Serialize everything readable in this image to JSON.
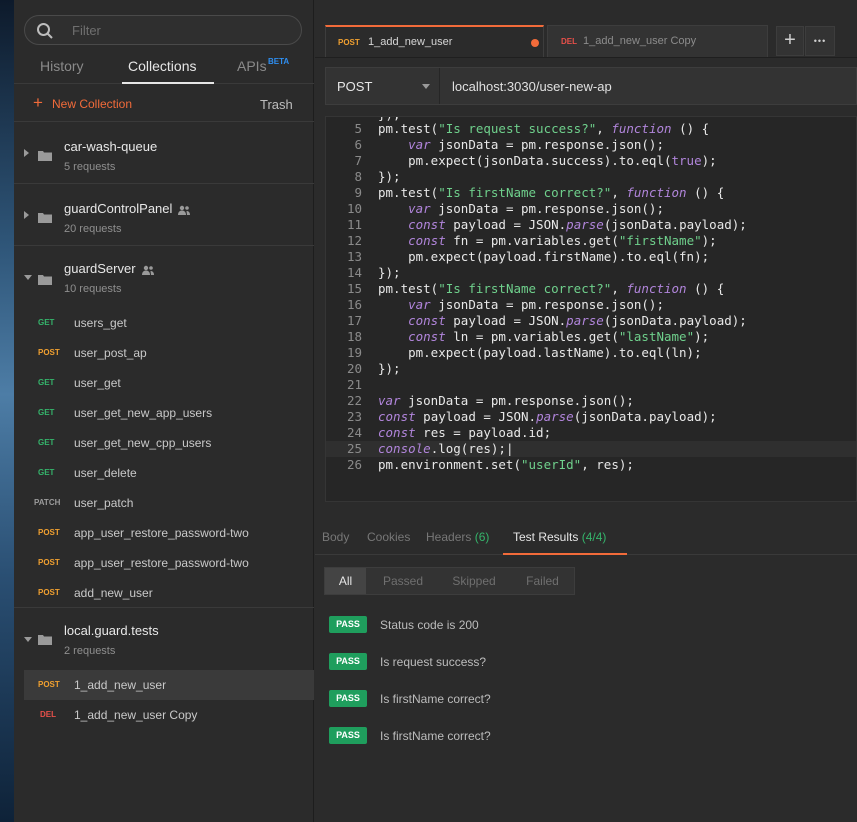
{
  "sidebar": {
    "filter_placeholder": "Filter",
    "tabs": [
      {
        "label": "History"
      },
      {
        "label": "Collections"
      },
      {
        "label": "APIs",
        "badge": "BETA"
      }
    ],
    "new_collection": "New Collection",
    "trash": "Trash",
    "collections": [
      {
        "name": "car-wash-queue",
        "count": "5 requests",
        "shared": false
      },
      {
        "name": "guardControlPanel",
        "count": "20 requests",
        "shared": true
      },
      {
        "name": "guardServer",
        "count": "10 requests",
        "shared": true,
        "requests": [
          {
            "method": "GET",
            "name": "users_get"
          },
          {
            "method": "POST",
            "name": "user_post_ap"
          },
          {
            "method": "GET",
            "name": "user_get"
          },
          {
            "method": "GET",
            "name": "user_get_new_app_users"
          },
          {
            "method": "GET",
            "name": "user_get_new_cpp_users"
          },
          {
            "method": "GET",
            "name": "user_delete"
          },
          {
            "method": "PATCH",
            "name": "user_patch"
          },
          {
            "method": "POST",
            "name": "app_user_restore_password-two"
          },
          {
            "method": "POST",
            "name": "app_user_restore_password-two"
          },
          {
            "method": "POST",
            "name": "add_new_user"
          }
        ]
      },
      {
        "name": "local.guard.tests",
        "count": "2 requests",
        "shared": false,
        "requests": [
          {
            "method": "POST",
            "name": "1_add_new_user"
          },
          {
            "method": "DEL",
            "name": "1_add_new_user Copy"
          }
        ]
      }
    ]
  },
  "tabs": [
    {
      "method": "POST",
      "name": "1_add_new_user",
      "unsaved": true
    },
    {
      "method": "DEL",
      "name": "1_add_new_user Copy",
      "unsaved": false
    }
  ],
  "tab_actions": {
    "add": "+",
    "more": "•••"
  },
  "request": {
    "method": "POST",
    "url": "localhost:3030/user-new-ap"
  },
  "code_lines": [
    {
      "n": "5",
      "code": "pm.test(\"Is request success?\", function () {"
    },
    {
      "n": "6",
      "code": "    var jsonData = pm.response.json();"
    },
    {
      "n": "7",
      "code": "    pm.expect(jsonData.success).to.eql(true);"
    },
    {
      "n": "8",
      "code": "});"
    },
    {
      "n": "9",
      "code": "pm.test(\"Is firstName correct?\", function () {"
    },
    {
      "n": "10",
      "code": "    var jsonData = pm.response.json();"
    },
    {
      "n": "11",
      "code": "    const payload = JSON.parse(jsonData.payload);"
    },
    {
      "n": "12",
      "code": "    const fn = pm.variables.get(\"firstName\");"
    },
    {
      "n": "13",
      "code": "    pm.expect(payload.firstName).to.eql(fn);"
    },
    {
      "n": "14",
      "code": "});"
    },
    {
      "n": "15",
      "code": "pm.test(\"Is firstName correct?\", function () {"
    },
    {
      "n": "16",
      "code": "    var jsonData = pm.response.json();"
    },
    {
      "n": "17",
      "code": "    const payload = JSON.parse(jsonData.payload);"
    },
    {
      "n": "18",
      "code": "    const ln = pm.variables.get(\"lastName\");"
    },
    {
      "n": "19",
      "code": "    pm.expect(payload.lastName).to.eql(ln);"
    },
    {
      "n": "20",
      "code": "});"
    },
    {
      "n": "21",
      "code": ""
    },
    {
      "n": "22",
      "code": "var jsonData = pm.response.json();"
    },
    {
      "n": "23",
      "code": "const payload = JSON.parse(jsonData.payload);"
    },
    {
      "n": "24",
      "code": "const res = payload.id;"
    },
    {
      "n": "25",
      "code": "console.log(res);"
    },
    {
      "n": "26",
      "code": "pm.environment.set(\"userId\", res);"
    }
  ],
  "response_tabs": [
    {
      "label": "Body",
      "count": ""
    },
    {
      "label": "Cookies",
      "count": ""
    },
    {
      "label": "Headers",
      "count": "(6)"
    },
    {
      "label": "Test Results",
      "count": "(4/4)"
    }
  ],
  "result_filters": [
    "All",
    "Passed",
    "Skipped",
    "Failed"
  ],
  "test_results": [
    {
      "status": "PASS",
      "name": "Status code is 200"
    },
    {
      "status": "PASS",
      "name": "Is request success?"
    },
    {
      "status": "PASS",
      "name": "Is firstName correct?"
    },
    {
      "status": "PASS",
      "name": "Is firstName correct?"
    }
  ],
  "colors": {
    "accent": "#f26b3a",
    "get": "#35b46b",
    "post": "#f0a030",
    "del": "#e8504a",
    "pass": "#1f9e5d"
  }
}
